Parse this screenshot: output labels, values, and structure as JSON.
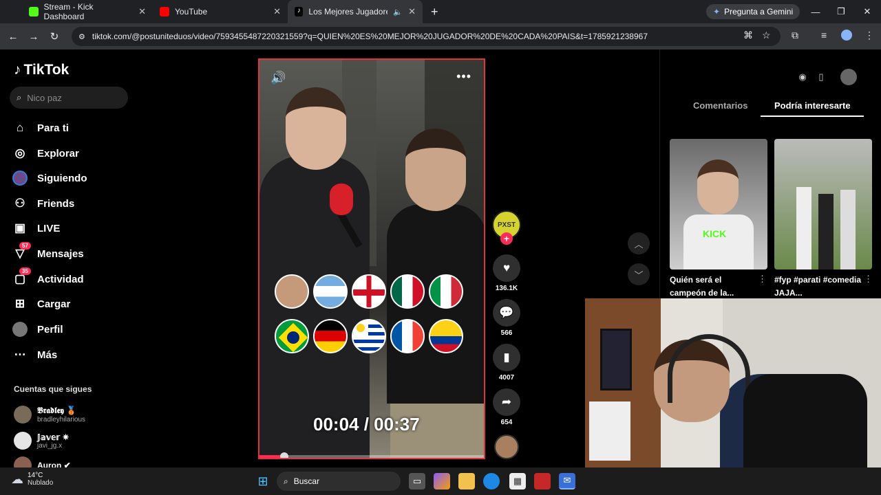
{
  "browser": {
    "tabs": [
      {
        "label": "Stream - Kick Dashboard",
        "color": "#53fc18"
      },
      {
        "label": "YouTube",
        "color": "#ff0000"
      },
      {
        "label": "Los Mejores Jugadores de",
        "color": "#ffffff"
      }
    ],
    "gemini_label": "Pregunta a Gemini",
    "url": "tiktok.com/@postuniteduos/video/7593455487220321559?q=QUIEN%20ES%20MEJOR%20JUGADOR%20DE%20CADA%20PAIS&t=1785921238967"
  },
  "sidebar": {
    "logo": "TikTok",
    "search_placeholder": "Nico paz",
    "items": [
      {
        "label": "Para ti",
        "icon": "home-icon",
        "glyph": "⌂"
      },
      {
        "label": "Explorar",
        "icon": "compass-icon",
        "glyph": "◎"
      },
      {
        "label": "Siguiendo",
        "icon": "following-avatar-icon",
        "glyph": "●"
      },
      {
        "label": "Friends",
        "icon": "friends-icon",
        "glyph": "⚇"
      },
      {
        "label": "LIVE",
        "icon": "live-tv-icon",
        "glyph": "▣"
      },
      {
        "label": "Mensajes",
        "icon": "messages-icon",
        "glyph": "▽",
        "badge": "57"
      },
      {
        "label": "Actividad",
        "icon": "activity-icon",
        "glyph": "▢",
        "badge": "35"
      },
      {
        "label": "Cargar",
        "icon": "upload-plus-icon",
        "glyph": "⊞"
      },
      {
        "label": "Perfil",
        "icon": "profile-avatar-icon",
        "glyph": "●"
      },
      {
        "label": "Más",
        "icon": "more-dots-icon",
        "glyph": "⋯"
      }
    ],
    "following_title": "Cuentas que sigues",
    "accounts": [
      {
        "name": "𝕭𝖗𝖆𝖉𝖑𝖊𝖞 🥉",
        "handle": "bradleyhilarious"
      },
      {
        "name": "𝕁𝕒𝕧𝕖𝕣 ✷",
        "handle": "javi_jg.x"
      },
      {
        "name": "Auron ✔",
        "handle": ""
      }
    ]
  },
  "video": {
    "timer": "00:04 / 00:37",
    "progress": 0.11,
    "flags_row1": [
      "player",
      "argentina",
      "england",
      "mexico",
      "italy"
    ],
    "flags_row2": [
      "brazil",
      "germany",
      "uruguay",
      "france",
      "colombia"
    ]
  },
  "actions": {
    "creator_label": "PXST",
    "likes": "136.1K",
    "comments": "566",
    "saves": "4007",
    "shares": "654"
  },
  "right_panel": {
    "tab_comments": "Comentarios",
    "tab_suggested": "Podría interesarte",
    "videos": [
      {
        "caption": "Quién será el campeón de la...",
        "thumb_text": "KICK"
      },
      {
        "caption": "#fyp #parati #comedia JAJA...",
        "thumb_text": ""
      }
    ]
  },
  "taskbar": {
    "temp": "14°C",
    "weather": "Nublado",
    "search": "Buscar"
  }
}
